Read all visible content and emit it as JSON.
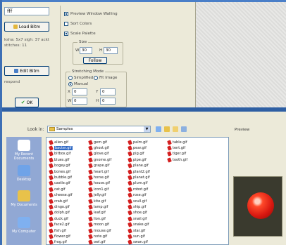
{
  "top": {
    "name_value": "fff",
    "load_label": "Load Bitm",
    "info_text": "ksha: 5x7 sigh: 37 ackt stitches: 11",
    "edit_label": "Edit Bitm",
    "status_text": "respond",
    "ok_label": "OK",
    "checkboxes": [
      {
        "label": "Preview Window Walling",
        "checked": true
      },
      {
        "label": "Sort Colors",
        "checked": false
      },
      {
        "label": "Scale Palette",
        "checked": true
      }
    ],
    "size_group_label": "Size",
    "size_w_label": "W",
    "size_w_value": "30",
    "size_h_label": "H",
    "size_h_value": "30",
    "apply_label": "Follow",
    "sizing_group_label": "Stretching Mode",
    "radio_options": [
      {
        "label": "Simplified",
        "selected": false
      },
      {
        "label": "Fit Image",
        "selected": false
      },
      {
        "label": "Manual",
        "selected": true
      }
    ],
    "offsets": [
      {
        "label": "X",
        "value": "0"
      },
      {
        "label": "Y",
        "value": "0"
      },
      {
        "label": "W",
        "value": "0"
      },
      {
        "label": "H",
        "value": "0"
      }
    ]
  },
  "dialog": {
    "lookin_label": "Look in:",
    "folder_name": "Samples",
    "preview_label": "Preview",
    "places": [
      {
        "label": "My Recent Documents",
        "color": "#ffffff"
      },
      {
        "label": "Desktop",
        "color": "#6fa3e8"
      },
      {
        "label": "My Documents",
        "color": "#e8c24a"
      },
      {
        "label": "My Computer",
        "color": "#7fb0f0"
      }
    ],
    "files": [
      "alien.gif",
      "bacter.gif",
      "bitbox.gif",
      "blues.gif",
      "bogey.gif",
      "bones.gif",
      "bubble.gif",
      "castle.gif",
      "cat.gif",
      "cheese.gif",
      "crab.gif",
      "dingo.gif",
      "dolph.gif",
      "duck.gif",
      "face2.gif",
      "fish.gif",
      "flower.gif",
      "frog.gif",
      "gem.gif",
      "ghost.gif",
      "glove.gif",
      "gnome.gif",
      "grape.gif",
      "heart.gif",
      "horse.gif",
      "house.gif",
      "icon1.gif",
      "jelly.gif",
      "kite.gif",
      "lamp.gif",
      "leaf.gif",
      "lion.gif",
      "moon.gif",
      "mouse.gif",
      "note.gif",
      "owl.gif",
      "palm.gif",
      "pear.gif",
      "pig.gif",
      "pipe.gif",
      "plane.gif",
      "plant2.gif",
      "planet.gif",
      "plum.gif",
      "robot.gif",
      "rose.gif",
      "scull.gif",
      "ship.gif",
      "shoe.gif",
      "snail.gif",
      "snake.gif",
      "star.gif",
      "sun.gif",
      "swan.gif",
      "table.gif",
      "tent.gif",
      "tiger.gif",
      "tooth.gif"
    ],
    "selected_file": "bacter.gif"
  }
}
